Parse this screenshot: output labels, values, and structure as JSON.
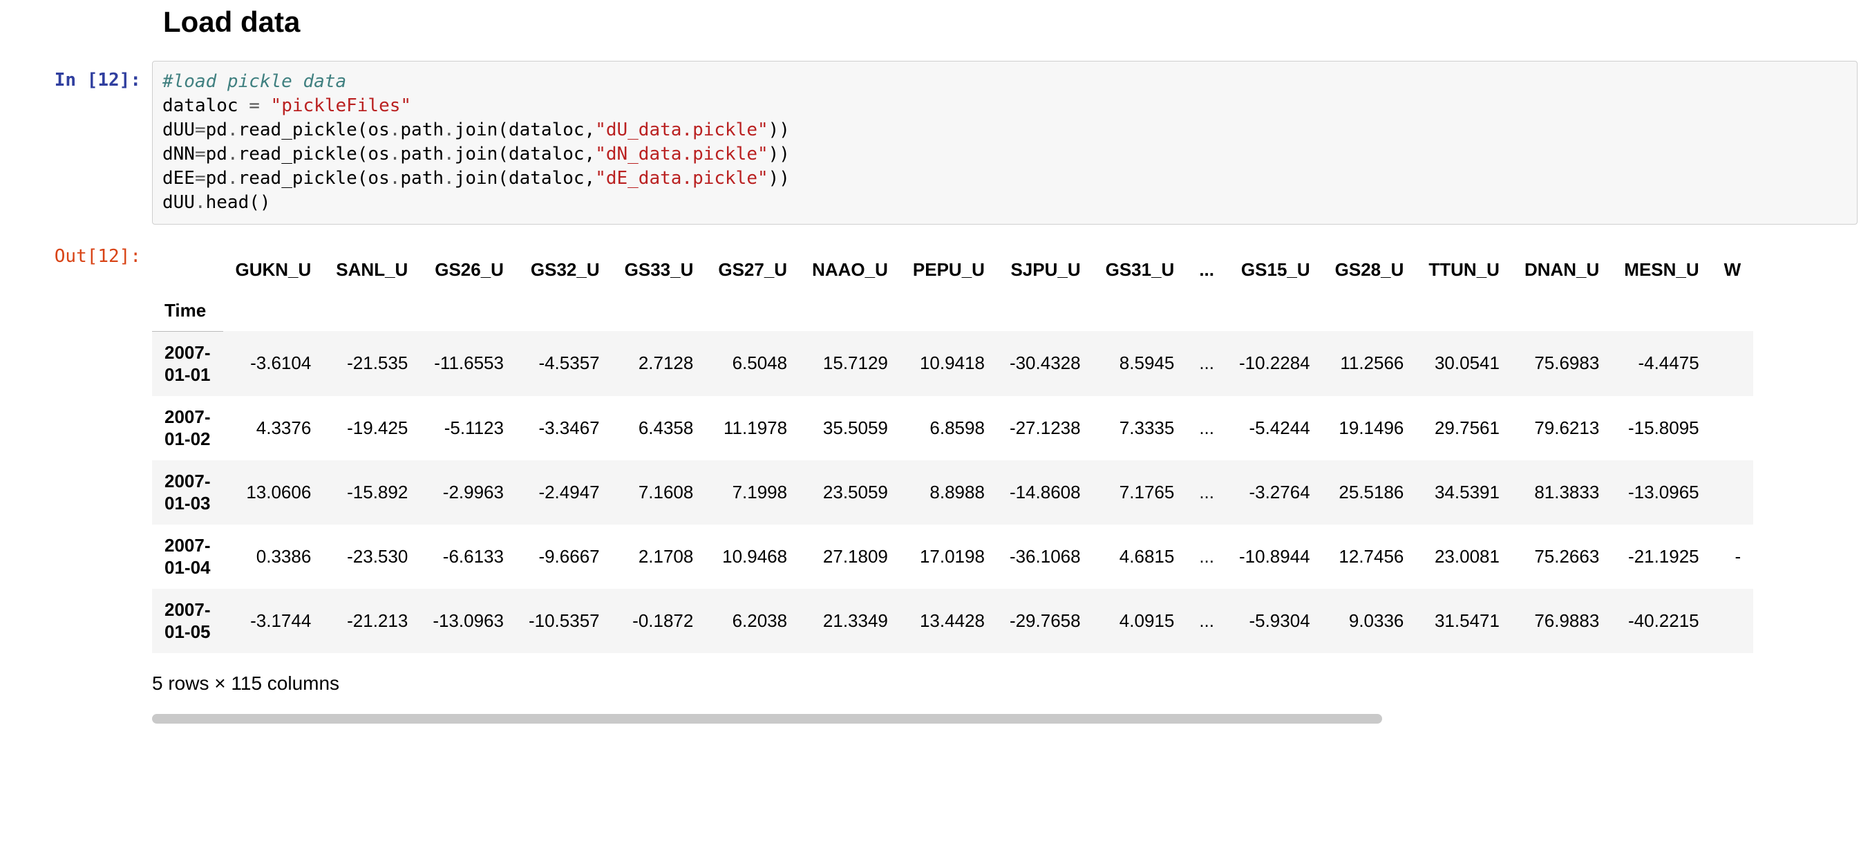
{
  "heading": "Load data",
  "prompts": {
    "in": "In [12]:",
    "out": "Out[12]:"
  },
  "code": {
    "comment": "#load pickle data",
    "l2_a": "dataloc ",
    "l2_eq": "=",
    "l2_sp": " ",
    "l2_str": "\"pickleFiles\"",
    "l3_a": "dUU",
    "l3_eq": "=",
    "l3_b": "pd",
    "l3_dot1": ".",
    "l3_c": "read_pickle(os",
    "l3_dot2": ".",
    "l3_d": "path",
    "l3_dot3": ".",
    "l3_e": "join(dataloc,",
    "l3_str": "\"dU_data.pickle\"",
    "l3_end": "))",
    "l4_a": "dNN",
    "l4_eq": "=",
    "l4_b": "pd",
    "l4_dot1": ".",
    "l4_c": "read_pickle(os",
    "l4_dot2": ".",
    "l4_d": "path",
    "l4_dot3": ".",
    "l4_e": "join(dataloc,",
    "l4_str": "\"dN_data.pickle\"",
    "l4_end": "))",
    "l5_a": "dEE",
    "l5_eq": "=",
    "l5_b": "pd",
    "l5_dot1": ".",
    "l5_c": "read_pickle(os",
    "l5_dot2": ".",
    "l5_d": "path",
    "l5_dot3": ".",
    "l5_e": "join(dataloc,",
    "l5_str": "\"dE_data.pickle\"",
    "l5_end": "))",
    "l6": "dUU",
    "l6_dot": ".",
    "l6_b": "head()"
  },
  "table": {
    "index_name": "Time",
    "columns": [
      "GUKN_U",
      "SANL_U",
      "GS26_U",
      "GS32_U",
      "GS33_U",
      "GS27_U",
      "NAAO_U",
      "PEPU_U",
      "SJPU_U",
      "GS31_U",
      "...",
      "GS15_U",
      "GS28_U",
      "TTUN_U",
      "DNAN_U",
      "MESN_U",
      "W"
    ],
    "rows": [
      {
        "index": "2007-\n01-01",
        "cells": [
          "-3.6104",
          "-21.535",
          "-11.6553",
          "-4.5357",
          "2.7128",
          "6.5048",
          "15.7129",
          "10.9418",
          "-30.4328",
          "8.5945",
          "...",
          "-10.2284",
          "11.2566",
          "30.0541",
          "75.6983",
          "-4.4475",
          ""
        ]
      },
      {
        "index": "2007-\n01-02",
        "cells": [
          "4.3376",
          "-19.425",
          "-5.1123",
          "-3.3467",
          "6.4358",
          "11.1978",
          "35.5059",
          "6.8598",
          "-27.1238",
          "7.3335",
          "...",
          "-5.4244",
          "19.1496",
          "29.7561",
          "79.6213",
          "-15.8095",
          ""
        ]
      },
      {
        "index": "2007-\n01-03",
        "cells": [
          "13.0606",
          "-15.892",
          "-2.9963",
          "-2.4947",
          "7.1608",
          "7.1998",
          "23.5059",
          "8.8988",
          "-14.8608",
          "7.1765",
          "...",
          "-3.2764",
          "25.5186",
          "34.5391",
          "81.3833",
          "-13.0965",
          ""
        ]
      },
      {
        "index": "2007-\n01-04",
        "cells": [
          "0.3386",
          "-23.530",
          "-6.6133",
          "-9.6667",
          "2.1708",
          "10.9468",
          "27.1809",
          "17.0198",
          "-36.1068",
          "4.6815",
          "...",
          "-10.8944",
          "12.7456",
          "23.0081",
          "75.2663",
          "-21.1925",
          "-"
        ]
      },
      {
        "index": "2007-\n01-05",
        "cells": [
          "-3.1744",
          "-21.213",
          "-13.0963",
          "-10.5357",
          "-0.1872",
          "6.2038",
          "21.3349",
          "13.4428",
          "-29.7658",
          "4.0915",
          "...",
          "-5.9304",
          "9.0336",
          "31.5471",
          "76.9883",
          "-40.2215",
          ""
        ]
      }
    ],
    "caption": "5 rows × 115 columns"
  }
}
